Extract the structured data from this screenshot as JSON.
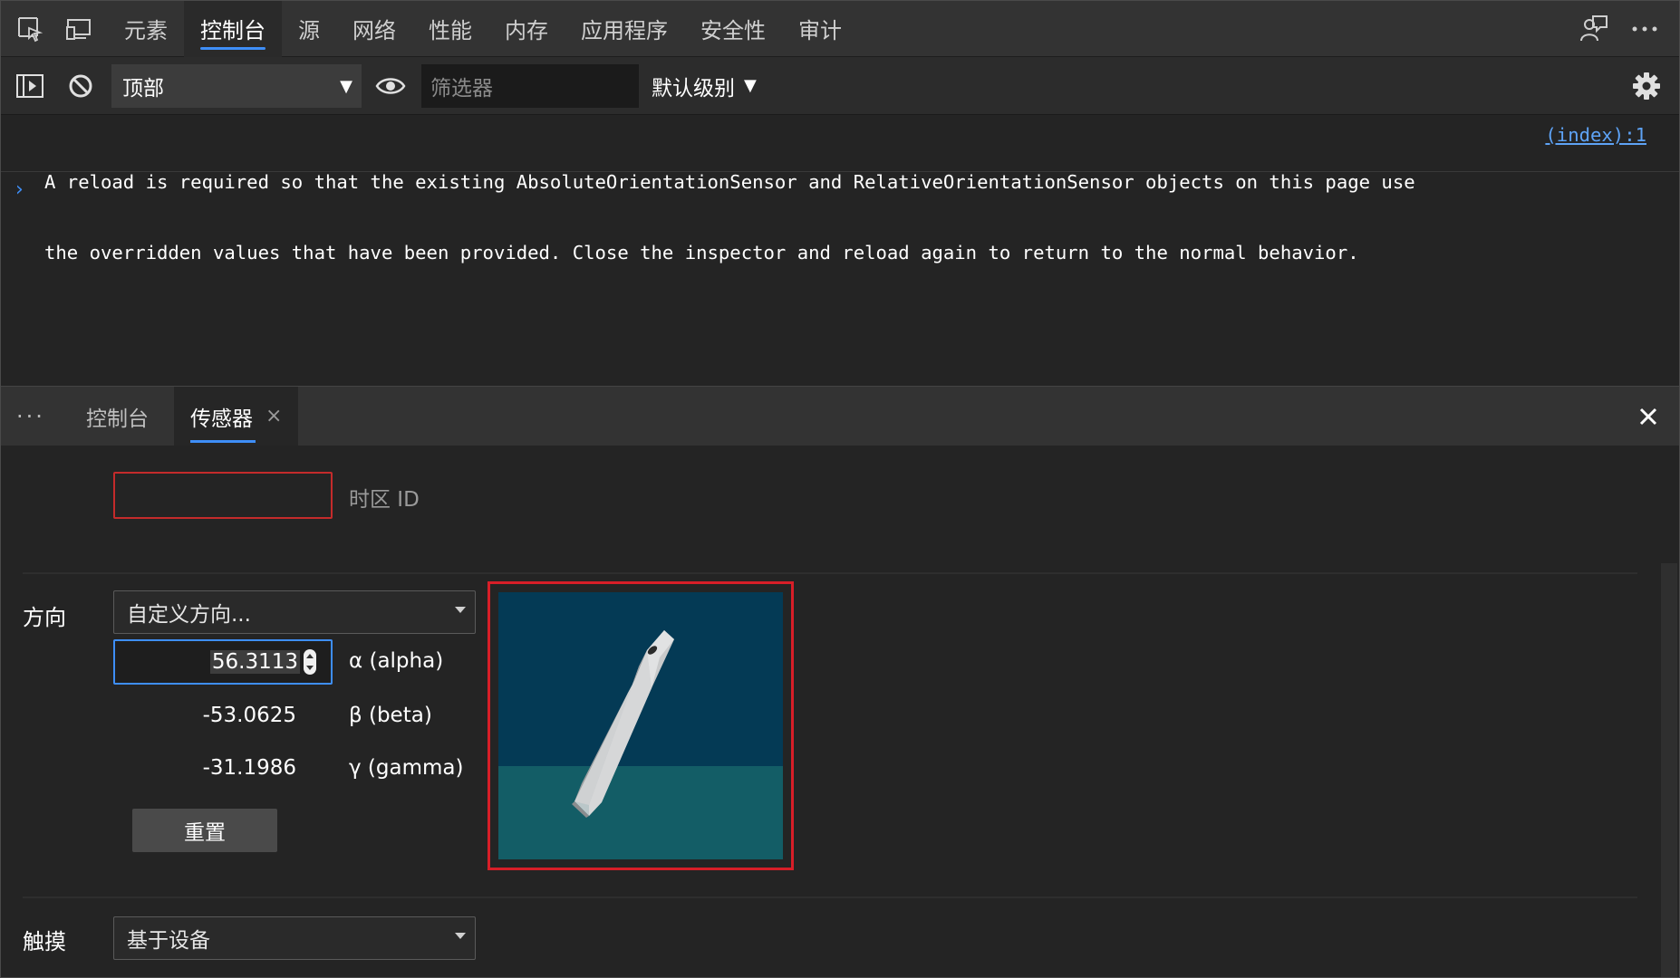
{
  "main_tabs": [
    "元素",
    "控制台",
    "源",
    "网络",
    "性能",
    "内存",
    "应用程序",
    "安全性",
    "审计"
  ],
  "active_main_tab": "控制台",
  "toolbar": {
    "context": "顶部",
    "filter_placeholder": "筛选器",
    "level": "默认级别"
  },
  "console": {
    "message_line1": "A reload is required so that the existing AbsoluteOrientationSensor and RelativeOrientationSensor objects on this page use",
    "message_line2": "the overridden values that have been provided. Close the inspector and reload again to return to the normal behavior.",
    "source_link": "(index):1",
    "prompt": "›"
  },
  "drawer": {
    "more": "···",
    "tabs": [
      "控制台",
      "传感器"
    ],
    "active_tab": "传感器",
    "tab_close": "×"
  },
  "sensors": {
    "timezone": {
      "value": "",
      "label": "时区 ID"
    },
    "orientation": {
      "label": "方向",
      "preset": "自定义方向...",
      "alpha": "56.3113",
      "alpha_label": "α (alpha)",
      "beta": "-53.0625",
      "beta_label": "β (beta)",
      "gamma": "-31.1986",
      "gamma_label": "γ (gamma)",
      "reset": "重置"
    },
    "touch": {
      "label": "触摸",
      "value": "基于设备"
    }
  },
  "colors": {
    "accent": "#3e8ef7",
    "error_border": "#c42b2b",
    "highlight_frame": "#d71e28",
    "sky": "#043a55",
    "ground": "#135d66"
  },
  "icons": [
    "inspect-icon",
    "device-emulation-icon",
    "feedback-icon",
    "more-icon",
    "sidebar-toggle-icon",
    "clear-console-icon",
    "eye-icon",
    "gear-icon",
    "close-icon"
  ]
}
